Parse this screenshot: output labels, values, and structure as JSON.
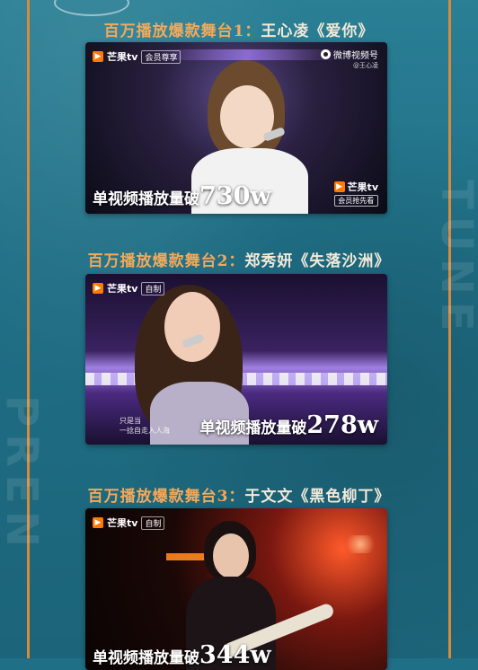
{
  "sections": [
    {
      "title_prefix": "百万播放爆款舞台1：",
      "title_rest": "王心凌《爱你》",
      "logo_text": "芒果tv",
      "logo_tag": "会员尊享",
      "watermark_main": "微博视频号",
      "watermark_sub": "@王心凌",
      "stat_label": "单视频播放量破",
      "stat_value": "730w",
      "corner_logo": "芒果tv",
      "corner_tag": "会员抢先看"
    },
    {
      "title_prefix": "百万播放爆款舞台2：",
      "title_rest": "郑秀妍《失落沙洲》",
      "logo_text": "芒果tv",
      "logo_tag": "自制",
      "subtitle_line1": "只是当",
      "subtitle_line2": "一捻自走入人海",
      "stat_label": "单视频播放量破",
      "stat_value": "278w"
    },
    {
      "title_prefix": "百万播放爆款舞台3：",
      "title_rest": "于文文《黑色柳丁》",
      "logo_text": "芒果tv",
      "logo_tag": "自制",
      "stat_label": "单视频播放量破",
      "stat_value": "344w"
    }
  ],
  "colors": {
    "background": "#1f6f86",
    "title_accent": "#f3a95a",
    "title_text": "#f2e9d8",
    "frame": "#d98a3a",
    "logo_orange": "#ff7a00"
  }
}
